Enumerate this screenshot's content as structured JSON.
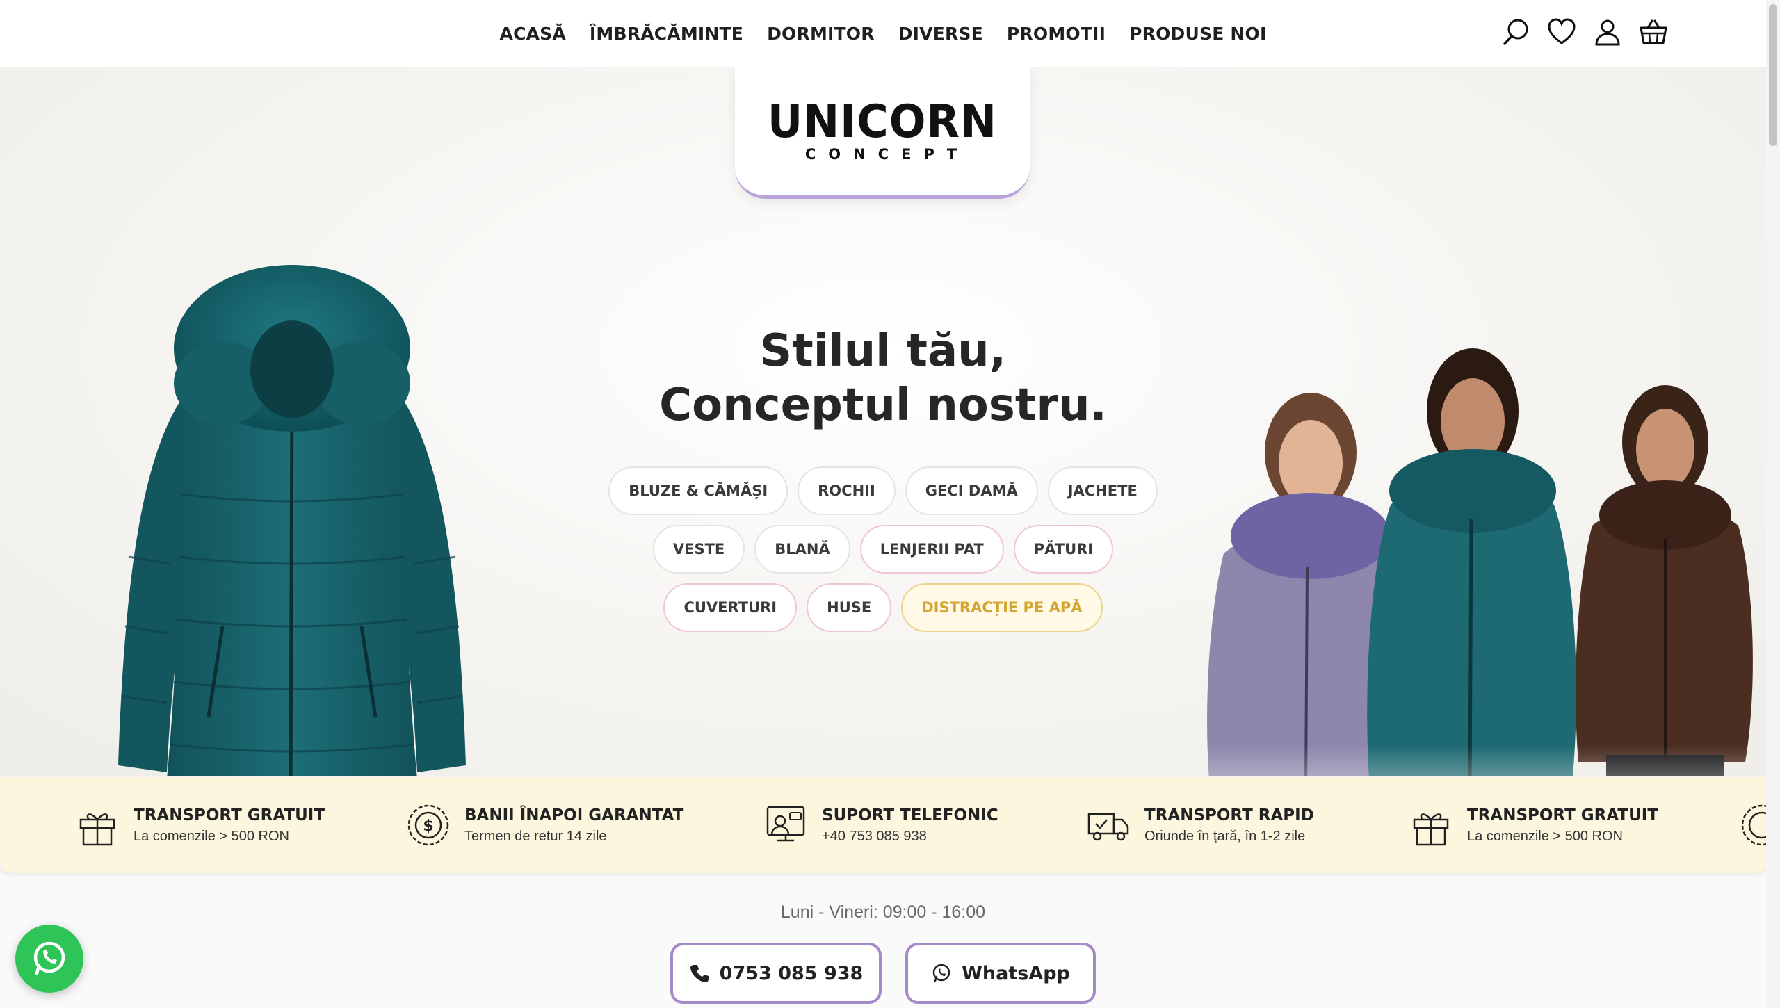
{
  "nav": {
    "items": [
      {
        "label": "ACASĂ"
      },
      {
        "label": "ÎMBRĂCĂMINTE"
      },
      {
        "label": "DORMITOR"
      },
      {
        "label": "DIVERSE"
      },
      {
        "label": "PROMOTII"
      },
      {
        "label": "PRODUSE NOI"
      }
    ],
    "icons": [
      "search-icon",
      "heart-icon",
      "user-icon",
      "basket-icon"
    ]
  },
  "logo": {
    "main": "UNICORN",
    "sub": "CONCEPT"
  },
  "hero": {
    "headline_line1": "Stilul tău,",
    "headline_line2": "Conceptul nostru.",
    "categories": [
      "BLUZE & CĂMĂȘI",
      "ROCHII",
      "GECI DAMĂ",
      "JACHETE",
      "VESTE",
      "BLANĂ",
      "LENJERII PAT",
      "PĂTURI",
      "CUVERTURI",
      "HUSE",
      "DISTRACȚIE PE APĂ"
    ]
  },
  "features": [
    {
      "icon": "gift-icon",
      "title": "TRANSPORT GRATUIT",
      "subtitle": "La comenzile > 500 RON"
    },
    {
      "icon": "money-back-icon",
      "title": "BANII ÎNAPOI GARANTAT",
      "subtitle": "Termen de retur 14 zile"
    },
    {
      "icon": "support-icon",
      "title": "SUPORT TELEFONIC",
      "subtitle": "+40 753 085 938"
    },
    {
      "icon": "truck-icon",
      "title": "TRANSPORT RAPID",
      "subtitle": "Oriunde în țară, în 1-2 zile"
    },
    {
      "icon": "gift-icon",
      "title": "TRANSPORT GRATUIT",
      "subtitle": "La comenzile > 500 RON"
    }
  ],
  "contact": {
    "hours": "Luni - Vineri: 09:00 - 16:00",
    "phone_label": "0753 085 938",
    "whatsapp_label": "WhatsApp"
  },
  "colors": {
    "accent_purple": "#a58ac9",
    "features_bg": "#fdf6de",
    "whatsapp_green": "#2fc457",
    "jacket_teal": "#1c6a72"
  }
}
